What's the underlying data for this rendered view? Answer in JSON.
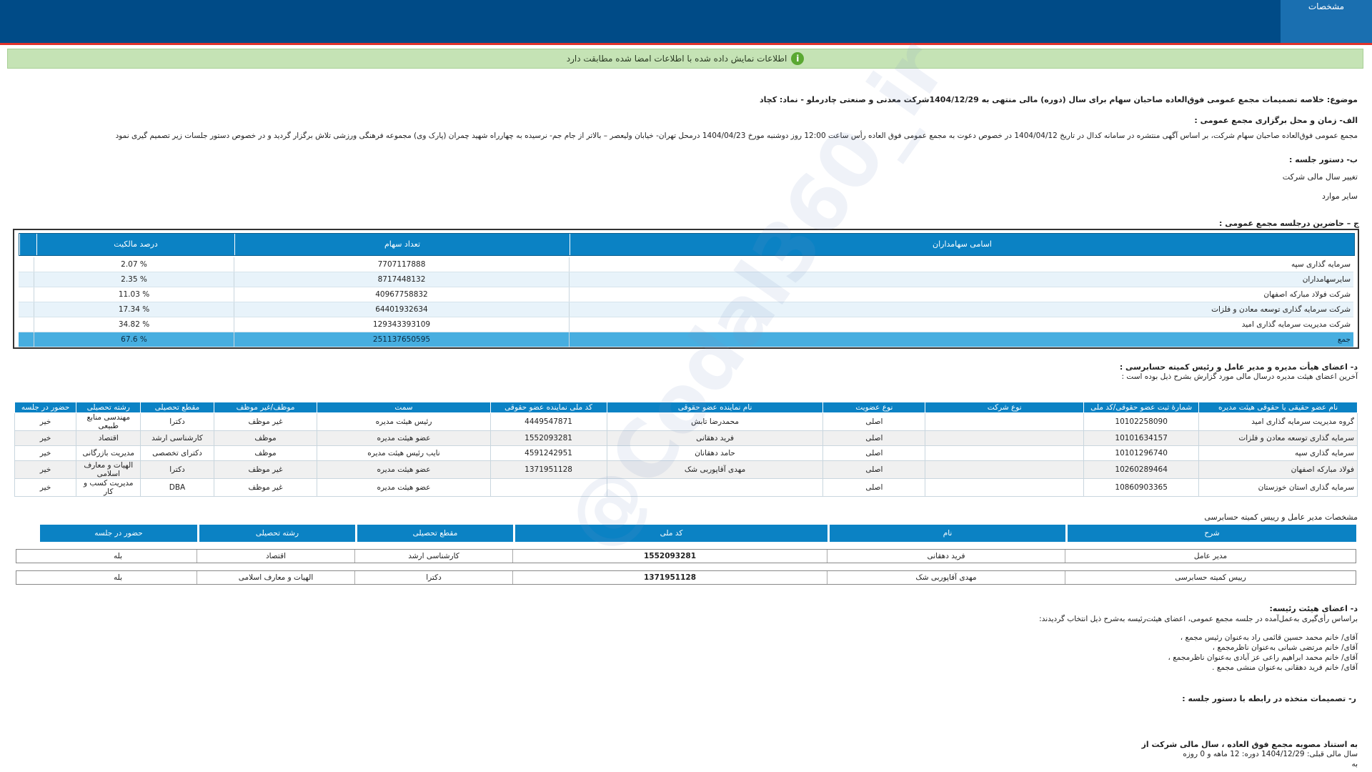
{
  "header": {
    "tab_label": "مشخصات"
  },
  "notice": {
    "text": "اطلاعات نمایش داده شده با اطلاعات امضا شده مطابقت دارد"
  },
  "subject": "موضوع: خلاصه تصمیمات مجمع عمومی فوق‌العاده صاحبان سهام برای سال (دوره) مالی منتهی به 1404/12/29شرکت معدنی و صنعتی چادرملو - نماد: کچاد",
  "section_a": {
    "title": "الف- زمان و محل برگزاری مجمع عمومی :",
    "text": "مجمع عمومی فوق‌العاده صاحبان سهام شرکت، بر اساس آگهی منتشره در سامانه کدال در تاریخ 1404/04/12 در خصوص دعوت به مجمع عمومی فوق العاده رأس ساعت 12:00 روز دوشنبه مورخ 1404/04/23 درمحل تهران- خیابان ولیعصر – بالاتر از جام جم- نرسیده به چهارراه شهید چمران (پارک وی) مجموعه فرهنگی ورزشی تلاش   برگزار گردید و در خصوص دستور جلسات زیر تصمیم گیری نمود"
  },
  "section_b": {
    "title": "ب- دستور جلسه :",
    "items": [
      "تغییر سال مالی شرکت",
      "سایر موارد"
    ]
  },
  "section_c": {
    "title": "ج – حاضرین درجلسه مجمع عمومی :",
    "headers": [
      "اسامی سهامداران",
      "تعداد سهام",
      "درصد مالکیت"
    ],
    "rows": [
      {
        "name": "سرمایه گذاری سپه",
        "shares": "7707117888",
        "pct": "2.07 %"
      },
      {
        "name": "سایرسهامداران",
        "shares": "8717448132",
        "pct": "2.35 %"
      },
      {
        "name": "شرکت فولاد مبارکه اصفهان",
        "shares": "40967758832",
        "pct": "11.03 %"
      },
      {
        "name": "شرکت سرمایه گذاری توسعه معادن و فلزات",
        "shares": "64401932634",
        "pct": "17.34 %"
      },
      {
        "name": "شرکت مدیریت سرمایه گذاری امید",
        "shares": "129343393109",
        "pct": "34.82 %"
      }
    ],
    "total": {
      "name": "جمع",
      "shares": "251137650595",
      "pct": "67.6 %"
    }
  },
  "section_d": {
    "title": "د- اعضای هیأت مدیره و مدیر عامل و رئیس کمیته حسابرسی :",
    "subtitle": "آخرین اعضای هیئت مدیره درسال مالی مورد گزارش بشرح ذیل بوده است :",
    "headers": [
      "نام عضو حقیقی یا حقوقی هیئت مدیره",
      "شمارهٔ ثبت عضو حقوقی/کد ملی",
      "نوع شرکت",
      "نوع عضویت",
      "نام نماینده عضو حقوقی",
      "کد ملی نماینده عضو حقوقی",
      "سمت",
      "موظف/غیر موظف",
      "مقطع تحصیلی",
      "رشته تحصیلی",
      "حضور در جلسه"
    ],
    "rows": [
      [
        "گروه مدیریت سرمایه گذاری امید",
        "10102258090",
        "",
        "اصلی",
        "محمدرضا تابش",
        "4449547871",
        "رئیس هیئت مدیره",
        "غیر موظف",
        "دکترا",
        "مهندسی منابع طبیعی",
        "خیر"
      ],
      [
        "سرمایه گذاری توسعه معادن و فلزات",
        "10101634157",
        "",
        "اصلی",
        "فرید دهقانی",
        "1552093281",
        "عضو هیئت مدیره",
        "موظف",
        "کارشناسی ارشد",
        "اقتصاد",
        "خیر"
      ],
      [
        "سرمایه گذاری سپه",
        "10101296740",
        "",
        "اصلی",
        "حامد دهقانان",
        "4591242951",
        "نایب رئیس هیئت مدیره",
        "موظف",
        "دکترای تخصصی",
        "مدیریت بازرگانی",
        "خیر"
      ],
      [
        "فولاد مبارکه اصفهان",
        "10260289464",
        "",
        "اصلی",
        "مهدی آقاپوربی شک",
        "1371951128",
        "عضو هیئت مدیره",
        "غیر موظف",
        "دکترا",
        "الهیات و معارف اسلامی",
        "خیر"
      ],
      [
        "سرمایه گذاری استان خوزستان",
        "10860903365",
        "",
        "اصلی",
        "",
        "",
        "عضو هیئت مدیره",
        "غیر موظف",
        "DBA",
        "مدیریت کسب و کار",
        "خیر"
      ]
    ]
  },
  "ceo": {
    "title": "مشخصات مدیر عامل و رییس کمیته حسابرسی",
    "headers": [
      "شرح",
      "نام",
      "کد ملی",
      "مقطع تحصیلی",
      "رشته تحصیلی",
      "حضور در جلسه"
    ],
    "rows": [
      [
        "مدیر عامل",
        "فرید دهقانی",
        "1552093281",
        "کارشناسی ارشد",
        "اقتصاد",
        "بله"
      ],
      [
        "رییس کمیته حسابرسی",
        "مهدی آقاپوربی شک",
        "1371951128",
        "دکترا",
        "الهیات و معارف اسلامی",
        "بله"
      ]
    ]
  },
  "section_e": {
    "title": "د- اعضای هیئت رئیسه:",
    "subtitle": "براساس رأی‌گیری به‌عمل‌آمده در جلسه مجمع عمومی، اعضای هیئت‌رئیسه به‌شرح ذیل انتخاب گردیدند:",
    "items": [
      "آقای/ خانم  محمد حسین قائمی راد  به‌عنوان رئیس مجمع ،",
      "آقای/ خانم  مرتضی شبانی  به‌عنوان ناظرمجمع ،",
      "آقای/ خانم  محمد ابراهیم راعی عز آبادی  به‌عنوان ناظرمجمع ،",
      "آقای/ خانم  فرید دهقانی  به‌عنوان منشی مجمع ."
    ]
  },
  "section_f": {
    "title": "ر- تصمیمات متخذه در رابطه با دستور جلسه :"
  },
  "footer": {
    "line1": "به استناد مصوبه مجمع فوق العاده ، سال مالی شرکت از",
    "line2": "سال مالی قبلی: 1404/12/29  دوره: 12 ماهه و 0 روزه",
    "line3": "به"
  },
  "watermark": "@Codal360_ir"
}
